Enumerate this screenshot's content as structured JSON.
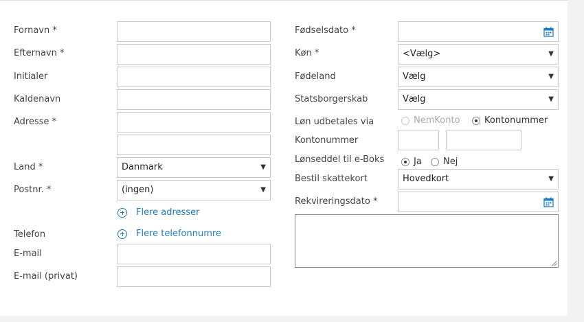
{
  "left": {
    "fornavn": {
      "label": "Fornavn *",
      "value": ""
    },
    "efternavn": {
      "label": "Efternavn *",
      "value": ""
    },
    "initialer": {
      "label": "Initialer",
      "value": ""
    },
    "kaldenavn": {
      "label": "Kaldenavn",
      "value": ""
    },
    "adresse": {
      "label": "Adresse *",
      "value": "",
      "value2": ""
    },
    "land": {
      "label": "Land *",
      "value": "Danmark"
    },
    "postnr": {
      "label": "Postnr. *",
      "value": "(ingen)"
    },
    "flere_adresser": "Flere adresser",
    "telefon": {
      "label": "Telefon"
    },
    "flere_telefonnumre": "Flere telefonnumre",
    "email": {
      "label": "E-mail",
      "value": ""
    },
    "email_privat": {
      "label": "E-mail (privat)",
      "value": ""
    }
  },
  "right": {
    "foedselsdato": {
      "label": "Fødselsdato *",
      "value": ""
    },
    "koen": {
      "label": "Køn *",
      "value": "<Vælg>"
    },
    "foedeland": {
      "label": "Fødeland",
      "value": "Vælg"
    },
    "statsborgerskab": {
      "label": "Statsborgerskab",
      "value": "Vælg"
    },
    "loen_udbetales": {
      "label": "Løn udbetales via",
      "option1": "NemKonto",
      "option2": "Kontonummer",
      "selected": "Kontonummer"
    },
    "kontonummer": {
      "label": "Kontonummer",
      "reg": "",
      "konto": ""
    },
    "loenseddel": {
      "label": "Lønseddel til e-Boks",
      "option1": "Ja",
      "option2": "Nej",
      "selected": "Ja"
    },
    "skattekort": {
      "label": "Bestil skattekort",
      "value": "Hovedkort"
    },
    "rekvireringsdato": {
      "label": "Rekvireringsdato *",
      "value": ""
    },
    "notes": ""
  },
  "colors": {
    "link": "#1e7bbf",
    "border": "#c8c8c8",
    "background": "#f2f2f2",
    "panel": "#ffffff"
  },
  "icons": {
    "calendar": "calendar-icon",
    "dropdown": "chevron-down-icon",
    "add": "plus-circle-icon"
  }
}
